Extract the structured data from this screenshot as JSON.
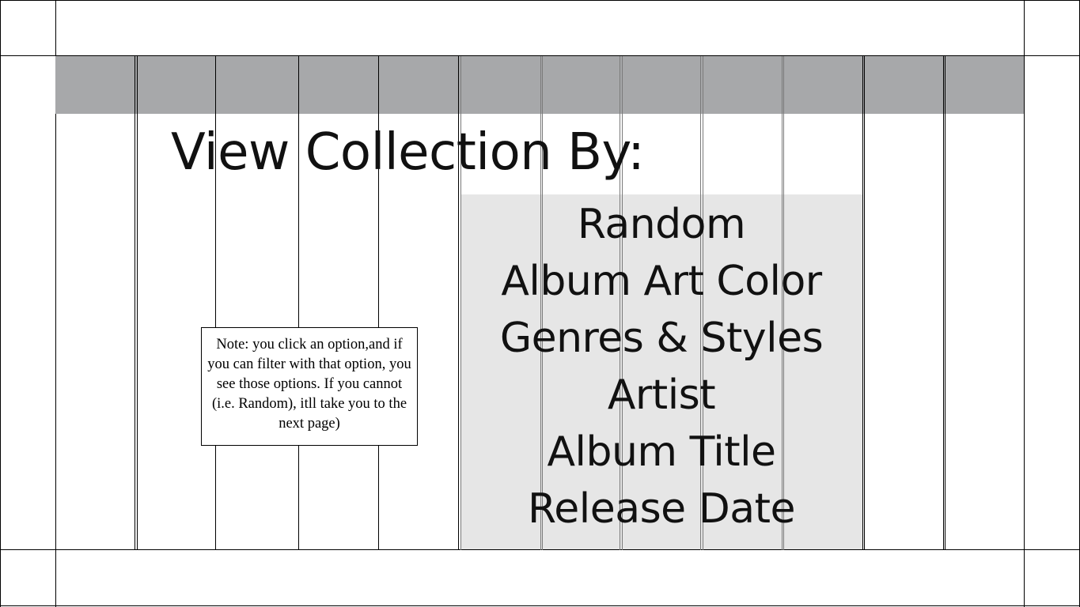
{
  "page": {
    "title": "View Collection By:"
  },
  "menu": {
    "options": [
      {
        "label": "Random"
      },
      {
        "label": "Album Art Color"
      },
      {
        "label": "Genres & Styles"
      },
      {
        "label": "Artist"
      },
      {
        "label": "Album Title"
      },
      {
        "label": "Release Date"
      }
    ]
  },
  "note": {
    "text": "Note: you click an option,and if you can filter with that option, you see those options. If you cannot (i.e. Random), itll take you to the next page)"
  },
  "colors": {
    "header_bar": "#a7a8aa",
    "menu_panel": "#e6e6e6",
    "grid_lines": "#000000"
  }
}
